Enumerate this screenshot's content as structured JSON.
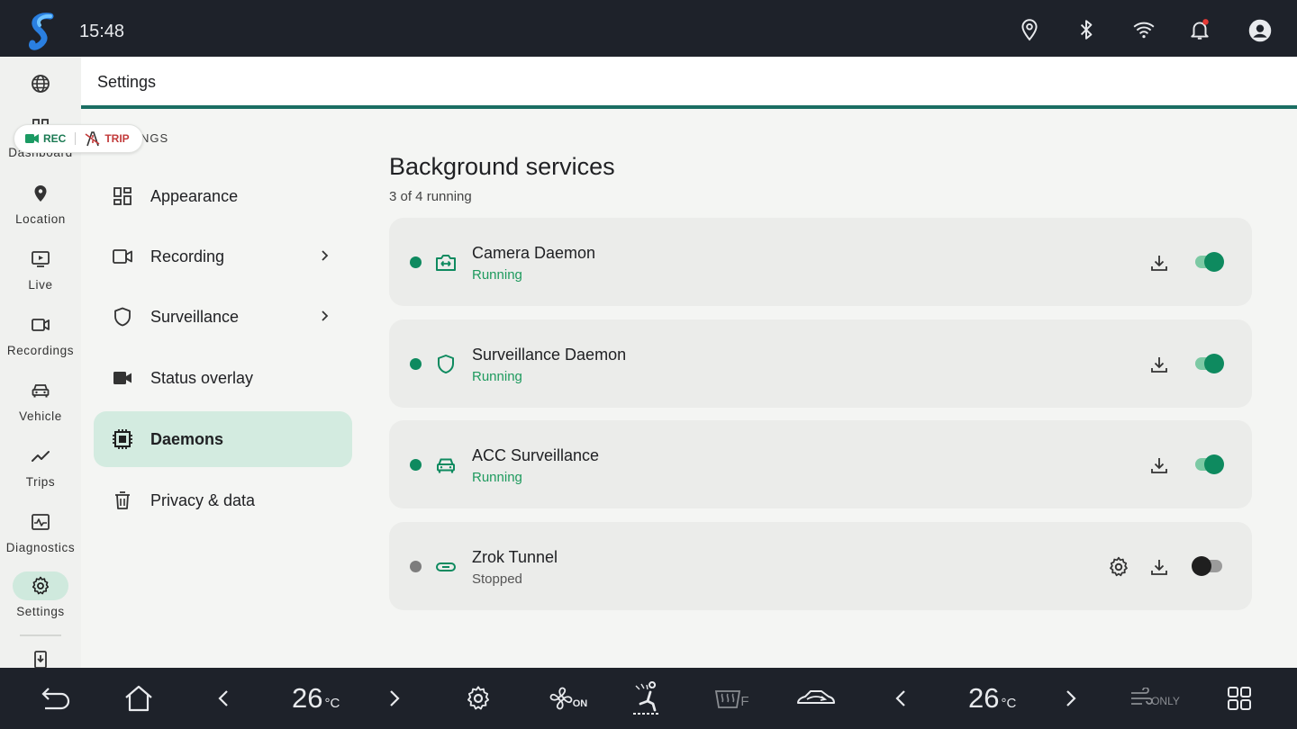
{
  "status_bar": {
    "time": "15:48",
    "icons": [
      "app-logo",
      "location-icon",
      "bluetooth-icon",
      "wifi-icon",
      "notification-bell-icon",
      "account-icon"
    ],
    "notification_dot_color": "#e53935"
  },
  "rail": {
    "items": [
      {
        "label": "",
        "icon": "globe-icon"
      },
      {
        "label": "Dashboard",
        "icon": "dashboard-icon"
      },
      {
        "label": "Location",
        "icon": "location-pin-icon"
      },
      {
        "label": "Live",
        "icon": "live-icon"
      },
      {
        "label": "Recordings",
        "icon": "recordings-icon"
      },
      {
        "label": "Vehicle",
        "icon": "vehicle-icon"
      },
      {
        "label": "Trips",
        "icon": "trips-icon"
      },
      {
        "label": "Diagnostics",
        "icon": "diagnostics-icon"
      },
      {
        "label": "Settings",
        "icon": "settings-icon",
        "active": true
      },
      {
        "label": "",
        "icon": "install-icon"
      }
    ]
  },
  "chip": {
    "rec_label": "REC",
    "trip_label": "TRIP"
  },
  "header": {
    "title": "Settings"
  },
  "settings": {
    "breadcrumb": "NGS",
    "items": [
      {
        "label": "Appearance",
        "icon": "appearance-icon"
      },
      {
        "label": "Recording",
        "icon": "recording-icon"
      },
      {
        "label": "Surveillance",
        "icon": "shield-icon"
      },
      {
        "label": "Status overlay",
        "icon": "status-overlay-icon"
      },
      {
        "label": "Daemons",
        "icon": "chip-icon",
        "active": true
      },
      {
        "label": "Privacy & data",
        "icon": "trash-icon"
      }
    ]
  },
  "content": {
    "title": "Background services",
    "subtitle": "3 of 4 running",
    "services": [
      {
        "name": "Camera Daemon",
        "status": "Running",
        "icon": "camera-switch-icon",
        "enabled": true
      },
      {
        "name": "Surveillance Daemon",
        "status": "Running",
        "icon": "shield-icon",
        "enabled": true
      },
      {
        "name": "ACC Surveillance",
        "status": "Running",
        "icon": "car-icon",
        "enabled": true
      },
      {
        "name": "Zrok Tunnel",
        "status": "Stopped",
        "icon": "link-icon",
        "enabled": false
      }
    ]
  },
  "bottom_bar": {
    "left_temp": "26",
    "right_temp": "26",
    "temp_unit": "°C",
    "fan_state": "ON",
    "defrost_label": "F",
    "airflow_label": "ONLY"
  },
  "colors": {
    "accent": "#0e8a5f",
    "running_text": "#1e9a5e",
    "stopped_text": "#555555",
    "active_bg": "#d3ebe0",
    "bar_bg": "#1e222a"
  }
}
